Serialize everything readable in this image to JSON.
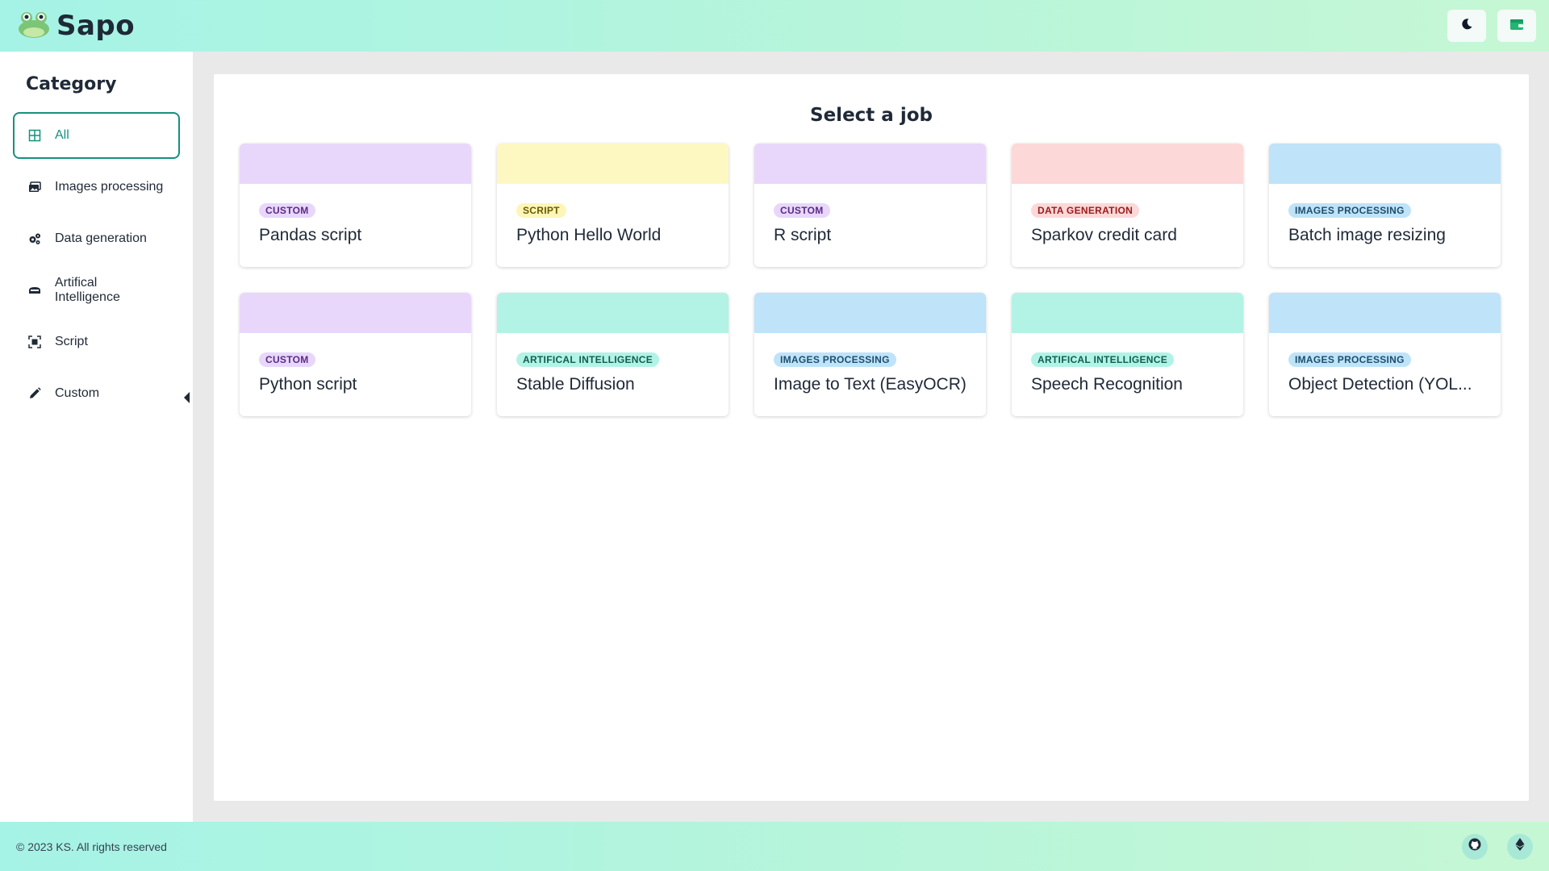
{
  "header": {
    "app_name": "Sapo",
    "logo_icon": "frog-icon",
    "theme_button_icon": "moon-icon",
    "wallet_button_icon": "wallet-icon",
    "accent_color": "#14917f"
  },
  "sidebar": {
    "title": "Category",
    "items": [
      {
        "label": "All",
        "icon": "grid-icon",
        "active": true
      },
      {
        "label": "Images processing",
        "icon": "images-icon",
        "active": false
      },
      {
        "label": "Data generation",
        "icon": "gears-icon",
        "active": false
      },
      {
        "label": "Artifical Intelligence",
        "icon": "robot-icon",
        "active": false
      },
      {
        "label": "Script",
        "icon": "scan-icon",
        "active": false
      },
      {
        "label": "Custom",
        "icon": "pencil-icon",
        "active": false
      }
    ]
  },
  "main": {
    "title": "Select a job",
    "jobs": [
      {
        "category": "CUSTOM",
        "title": "Pandas script",
        "band_color": "#e8d7fb",
        "badge_bg": "#e8d7fb",
        "badge_fg": "#5b2a86"
      },
      {
        "category": "SCRIPT",
        "title": "Python Hello World",
        "band_color": "#fdf8c2",
        "badge_bg": "#fdf6b8",
        "badge_fg": "#6b5b00"
      },
      {
        "category": "CUSTOM",
        "title": "R script",
        "band_color": "#e8d7fb",
        "badge_bg": "#e8d7fb",
        "badge_fg": "#5b2a86"
      },
      {
        "category": "DATA GENERATION",
        "title": "Sparkov credit card",
        "band_color": "#fdd8d8",
        "badge_bg": "#fdd8d8",
        "badge_fg": "#991b1b"
      },
      {
        "category": "IMAGES PROCESSING",
        "title": "Batch image resizing",
        "band_color": "#bfe3f8",
        "badge_bg": "#bfe3f8",
        "badge_fg": "#1e4e6f"
      },
      {
        "category": "CUSTOM",
        "title": "Python script",
        "band_color": "#e8d7fb",
        "badge_bg": "#e8d7fb",
        "badge_fg": "#5b2a86"
      },
      {
        "category": "ARTIFICAL INTELLIGENCE",
        "title": "Stable Diffusion",
        "band_color": "#b2f3e6",
        "badge_bg": "#b2f3e6",
        "badge_fg": "#115e52"
      },
      {
        "category": "IMAGES PROCESSING",
        "title": "Image to Text (EasyOCR)",
        "band_color": "#bfe3f8",
        "badge_bg": "#bfe3f8",
        "badge_fg": "#1e4e6f"
      },
      {
        "category": "ARTIFICAL INTELLIGENCE",
        "title": "Speech Recognition",
        "band_color": "#b2f3e6",
        "badge_bg": "#b2f3e6",
        "badge_fg": "#115e52"
      },
      {
        "category": "IMAGES PROCESSING",
        "title": "Object Detection (YOL...",
        "band_color": "#bfe3f8",
        "badge_bg": "#bfe3f8",
        "badge_fg": "#1e4e6f"
      }
    ]
  },
  "footer": {
    "copyright": "© 2023 KS. All rights reserved",
    "github_icon": "github-icon",
    "ethereum_icon": "ethereum-icon"
  }
}
